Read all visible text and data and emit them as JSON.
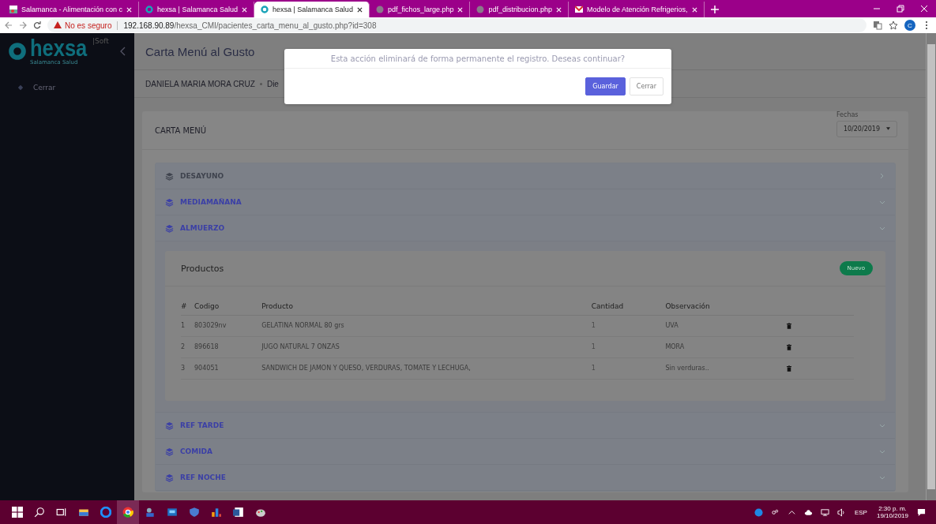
{
  "browser": {
    "tabs": [
      {
        "title": "Salamanca - Alimentación con c",
        "selected": false
      },
      {
        "title": "hexsa | Salamanca Salud",
        "selected": false
      },
      {
        "title": "hexsa | Salamanca Salud",
        "selected": true
      },
      {
        "title": "pdf_fichos_large.php",
        "selected": false
      },
      {
        "title": "pdf_distribucion.php",
        "selected": false
      },
      {
        "title": "Modelo de Atención Refrigerios,",
        "selected": false
      }
    ],
    "security": "No es seguro",
    "url_host": "192.168.90.89",
    "url_path": "/hexsa_CMI/pacientes_carta_menu_al_gusto.php?id=308",
    "profile": "C"
  },
  "sidebar": {
    "logo": "hexsa",
    "logo_suffix": "|Soft",
    "logo_sub": "Salamanca Salud",
    "items": [
      {
        "label": "Cerrar"
      }
    ]
  },
  "page": {
    "title": "Carta Menú al Gusto",
    "patient": "DANIELA MARIA MORA CRUZ",
    "patient_extra": "Die"
  },
  "modal": {
    "message": "Esta acción eliminará de forma permanente el registro. Deseas continuar?",
    "buttons": [
      {
        "label": "Guardar",
        "kind": "primary"
      },
      {
        "label": "Cerrar",
        "kind": "secondary"
      }
    ]
  },
  "card": {
    "title": "CARTA MENÚ",
    "date_label": "Fechas",
    "date_value": "10/20/2019",
    "meals": [
      {
        "label": "DESAYUNO",
        "disabled": true
      },
      {
        "label": "MEDIAMAÑANA",
        "disabled": false
      },
      {
        "label": "ALMUERZO",
        "disabled": false,
        "products": {
          "title": "Productos",
          "new_button": "Nuevo",
          "columns": [
            "#",
            "Codigo",
            "Producto",
            "Cantidad",
            "Observación"
          ],
          "rows": [
            [
              "1",
              "803029nv",
              "GELATINA NORMAL 80 grs",
              "1",
              "UVA"
            ],
            [
              "2",
              "896618",
              "JUGO NATURAL 7 ONZAS",
              "1",
              "MORA"
            ],
            [
              "3",
              "904051",
              "SANDWICH DE JAMON Y QUESO, VERDURAS, TOMATE Y LECHUGA,",
              "1",
              "Sin verduras.."
            ]
          ]
        }
      },
      {
        "label": "REF TARDE",
        "disabled": false
      },
      {
        "label": "COMIDA",
        "disabled": false
      },
      {
        "label": "REF NOCHE",
        "disabled": false
      }
    ]
  },
  "taskbar": {
    "language": "ESP",
    "time": "2:30 p. m.",
    "date": "19/10/2019"
  }
}
